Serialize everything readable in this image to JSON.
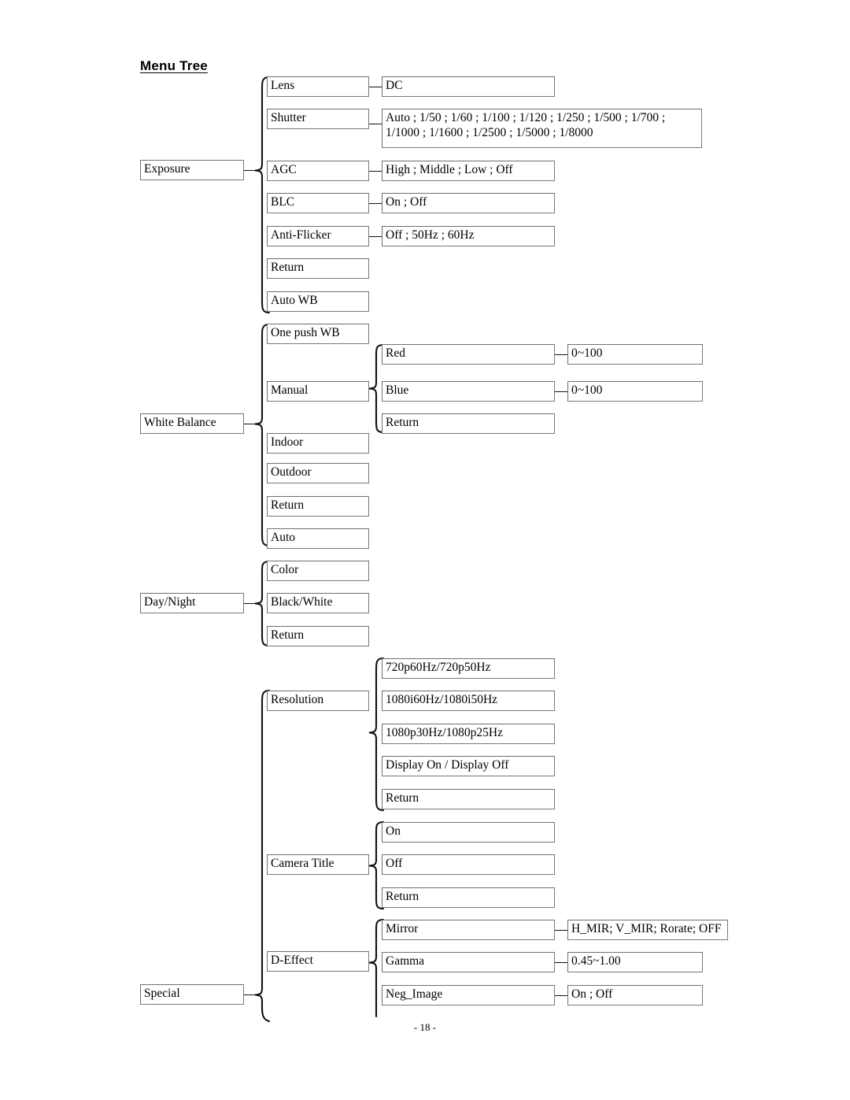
{
  "page": {
    "title": "Menu Tree",
    "footer": "- 18 -"
  },
  "menu_tree": {
    "exposure": {
      "label": "Exposure",
      "items": [
        {
          "label": "Lens",
          "value": "DC"
        },
        {
          "label": "Shutter",
          "value_line1": "Auto ; 1/50 ; 1/60 ; 1/100 ; 1/120 ; 1/250 ; 1/500 ; 1/700 ;",
          "value_line2": "1/1000 ; 1/1600 ; 1/2500 ; 1/5000 ; 1/8000"
        },
        {
          "label": "AGC",
          "value": "High ; Middle ; Low ; Off"
        },
        {
          "label": "BLC",
          "value": "On ; Off"
        },
        {
          "label": "Anti-Flicker",
          "value": "Off ; 50Hz ; 60Hz"
        },
        {
          "label": "Return",
          "value": ""
        },
        {
          "label": "Auto WB",
          "value": ""
        }
      ]
    },
    "white_balance": {
      "label": "White Balance",
      "items": [
        {
          "label": "One push WB"
        },
        {
          "label": "Manual"
        },
        {
          "label": "Indoor"
        },
        {
          "label": "Outdoor"
        },
        {
          "label": "Return"
        },
        {
          "label": "Auto"
        }
      ],
      "manual_children": [
        {
          "label": "Red",
          "value": "0~100"
        },
        {
          "label": "Blue",
          "value": "0~100"
        },
        {
          "label": "Return",
          "value": ""
        }
      ]
    },
    "day_night": {
      "label": "Day/Night",
      "items": [
        {
          "label": "Color"
        },
        {
          "label": "Black/White"
        },
        {
          "label": "Return"
        }
      ]
    },
    "special": {
      "label": "Special",
      "items": [
        {
          "label": "Resolution"
        },
        {
          "label": "Camera Title"
        },
        {
          "label": "D-Effect"
        }
      ],
      "resolution_children": [
        {
          "label": "720p60Hz/720p50Hz"
        },
        {
          "label": "1080i60Hz/1080i50Hz"
        },
        {
          "label": "1080p30Hz/1080p25Hz"
        },
        {
          "label": "Display On / Display Off"
        },
        {
          "label": "Return"
        }
      ],
      "camera_title_children": [
        {
          "label": "On"
        },
        {
          "label": "Off"
        },
        {
          "label": "Return"
        }
      ],
      "deffect_children": [
        {
          "label": "Mirror",
          "value": "H_MIR; V_MIR; Rorate; OFF"
        },
        {
          "label": "Gamma",
          "value": "0.45~1.00"
        },
        {
          "label": "Neg_Image",
          "value": "On ; Off"
        }
      ]
    }
  }
}
